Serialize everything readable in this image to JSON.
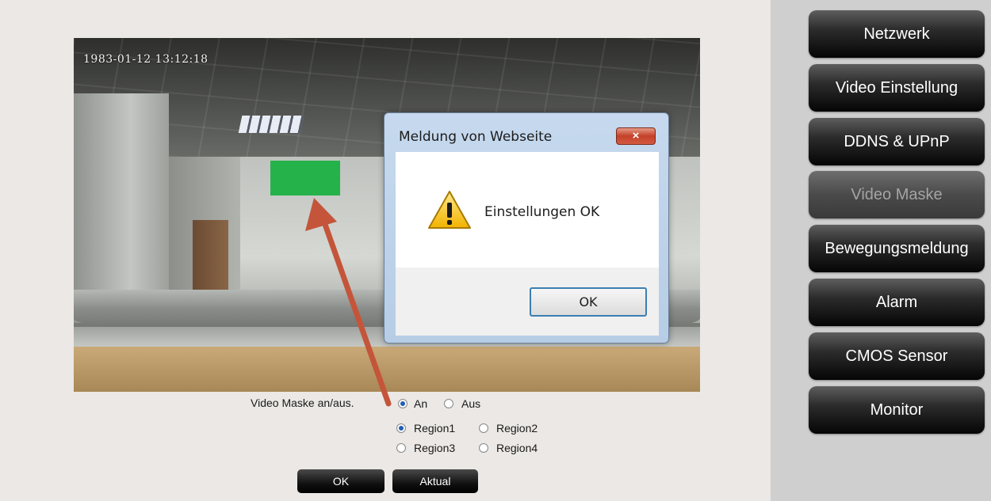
{
  "video": {
    "timestamp": "1983-01-12 13:12:18"
  },
  "dialog": {
    "title": "Meldung von Webseite",
    "close_label": "×",
    "message": "Einstellungen OK",
    "ok_label": "OK"
  },
  "mask_controls": {
    "label": "Video Maske an/aus.",
    "toggle_options": [
      {
        "label": "An",
        "checked": true
      },
      {
        "label": "Aus",
        "checked": false
      }
    ],
    "regions": [
      {
        "label": "Region1",
        "checked": true
      },
      {
        "label": "Region2",
        "checked": false
      },
      {
        "label": "Region3",
        "checked": false
      },
      {
        "label": "Region4",
        "checked": false
      }
    ],
    "ok_label": "OK",
    "refresh_label": "Aktual"
  },
  "sidebar": {
    "items": [
      {
        "label": "Netzwerk",
        "active": false
      },
      {
        "label": "Video Einstellung",
        "active": false
      },
      {
        "label": "DDNS & UPnP",
        "active": false
      },
      {
        "label": "Video Maske",
        "active": true
      },
      {
        "label": "Bewegungsmeldung",
        "active": false
      },
      {
        "label": "Alarm",
        "active": false
      },
      {
        "label": "CMOS Sensor",
        "active": false
      },
      {
        "label": "Monitor",
        "active": false
      }
    ]
  },
  "colors": {
    "mask_region": "#25b24a",
    "arrow": "#c4553a",
    "dialog_frame": "#b7cde6",
    "sidebar_bg": "#cfcfcf"
  }
}
